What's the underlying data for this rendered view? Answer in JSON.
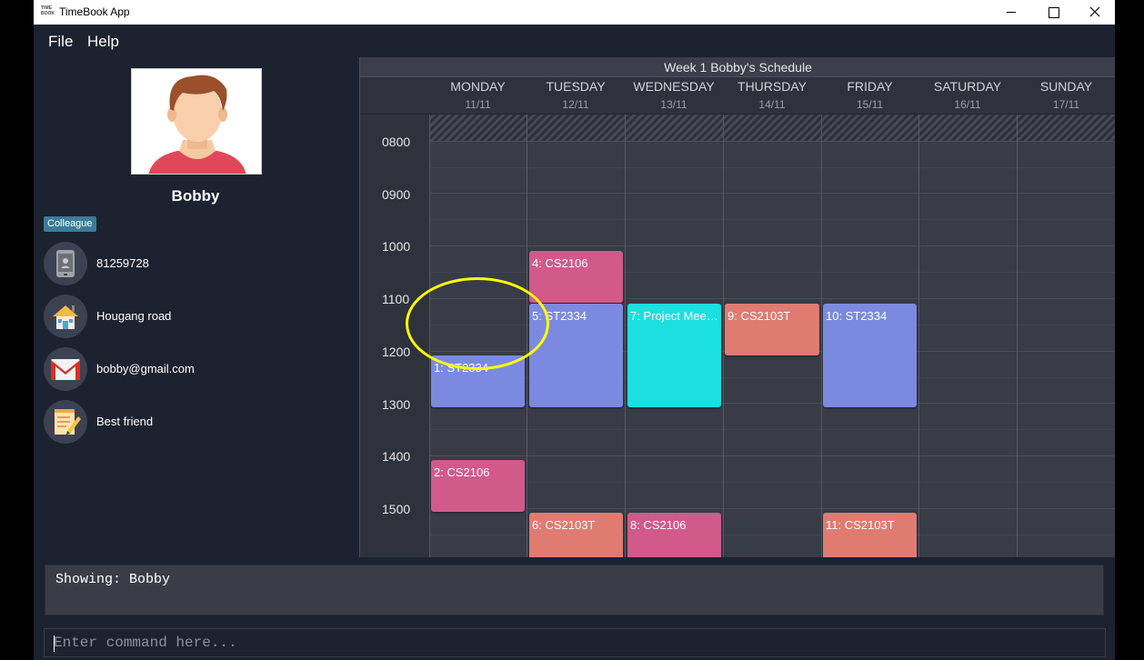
{
  "window": {
    "title": "TimeBook App",
    "icon_text": "TIME BOOK"
  },
  "menu": {
    "file": "File",
    "help": "Help"
  },
  "person": {
    "name": "Bobby",
    "tag": "Colleague",
    "phone": "81259728",
    "address": "Hougang road",
    "email": "bobby@gmail.com",
    "remark": "Best friend"
  },
  "schedule": {
    "title": "Week 1 Bobby's Schedule",
    "days": [
      {
        "name": "MONDAY",
        "date": "11/11"
      },
      {
        "name": "TUESDAY",
        "date": "12/11"
      },
      {
        "name": "WEDNESDAY",
        "date": "13/11"
      },
      {
        "name": "THURSDAY",
        "date": "14/11"
      },
      {
        "name": "FRIDAY",
        "date": "15/11"
      },
      {
        "name": "SATURDAY",
        "date": "16/11"
      },
      {
        "name": "SUNDAY",
        "date": "17/11"
      }
    ],
    "times": [
      "0800",
      "0900",
      "1000",
      "1100",
      "1200",
      "1300",
      "1400",
      "1500"
    ],
    "events": [
      {
        "label": "1: ST2334",
        "day": "MONDAY",
        "start": "1100",
        "end": "1200",
        "color": "#7b8ae0"
      },
      {
        "label": "2: CS2106",
        "day": "MONDAY",
        "start": "1300",
        "end": "1400",
        "color": "#d15a8a"
      },
      {
        "label": "4: CS2106",
        "day": "TUESDAY",
        "start": "0900",
        "end": "1000",
        "color": "#d15a8a"
      },
      {
        "label": "5: ST2334",
        "day": "TUESDAY",
        "start": "1000",
        "end": "1200",
        "color": "#7b8ae0"
      },
      {
        "label": "6: CS2103T",
        "day": "TUESDAY",
        "start": "1400",
        "end": "1600",
        "color": "#e07b72"
      },
      {
        "label": "7: Project Meet...",
        "day": "WEDNESDAY",
        "start": "1000",
        "end": "1200",
        "color": "#1bdfe0"
      },
      {
        "label": "8: CS2106",
        "day": "WEDNESDAY",
        "start": "1400",
        "end": "1600",
        "color": "#d15a8a"
      },
      {
        "label": "9: CS2103T",
        "day": "THURSDAY",
        "start": "1000",
        "end": "1100",
        "color": "#e07b72"
      },
      {
        "label": "10: ST2334",
        "day": "FRIDAY",
        "start": "1000",
        "end": "1200",
        "color": "#7b8ae0"
      },
      {
        "label": "11: CS2103T",
        "day": "FRIDAY",
        "start": "1400",
        "end": "1600",
        "color": "#e07b72"
      }
    ]
  },
  "result": {
    "text": "Showing: Bobby"
  },
  "command": {
    "placeholder": "Enter command here...",
    "value": ""
  },
  "icons": {
    "phone": "phone-icon",
    "address": "house-icon",
    "email": "gmail-icon",
    "remark": "notepad-icon",
    "avatar": "avatar-icon"
  }
}
